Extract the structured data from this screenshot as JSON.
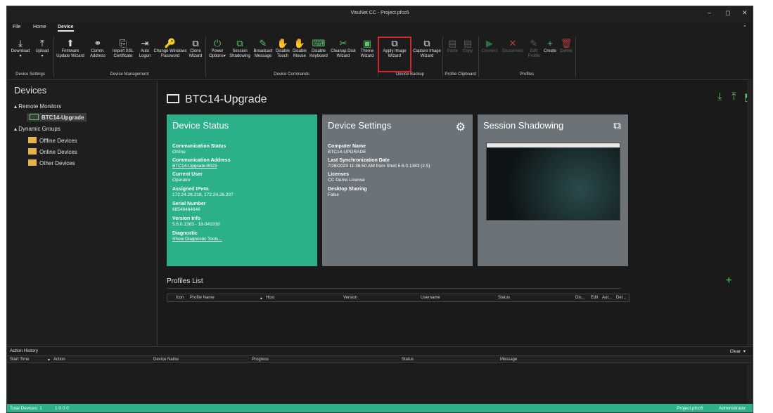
{
  "window": {
    "title": "VisuNet CC - Project.pfcc6",
    "minimize": "–",
    "maximize": "◻",
    "close": "✕"
  },
  "menu": {
    "file": "File",
    "home": "Home",
    "device": "Device",
    "collapse": "⌃"
  },
  "ribbon": {
    "buttons": [
      {
        "label": "Download",
        "icon": "⤓"
      },
      {
        "label": "Upload",
        "icon": "⤒"
      },
      {
        "label": "Firmware Update Wizard",
        "icon": "⬆"
      },
      {
        "label": "Comm. Address",
        "icon": "⚭"
      },
      {
        "label": "Import SSL Certificate",
        "icon": "⎘"
      },
      {
        "label": "Auto Logon",
        "icon": "⇥"
      },
      {
        "label": "Change Windows Password",
        "icon": "🔑"
      },
      {
        "label": "Clone Wizard",
        "icon": "⧉"
      },
      {
        "label": "Power Options",
        "icon": "⏻"
      },
      {
        "label": "Session Shadowing",
        "icon": "⧉"
      },
      {
        "label": "Broadcast Message",
        "icon": "✎"
      },
      {
        "label": "Disable Touch",
        "icon": "✋"
      },
      {
        "label": "Disable Mouse",
        "icon": "✋"
      },
      {
        "label": "Disable Keyboard",
        "icon": "⌨"
      },
      {
        "label": "Cleanup Disk Wizard",
        "icon": "✂"
      },
      {
        "label": "Theme Wizard",
        "icon": "▣"
      },
      {
        "label": "Apply Image Wizard",
        "icon": "⧉"
      },
      {
        "label": "Capture Image Wizard",
        "icon": "⧉"
      },
      {
        "label": "Paste",
        "icon": "▤"
      },
      {
        "label": "Copy",
        "icon": "▤"
      },
      {
        "label": "Connect",
        "icon": "▶"
      },
      {
        "label": "Disconnect",
        "icon": "✕"
      },
      {
        "label": "Edit Profile",
        "icon": "✎"
      },
      {
        "label": "Create",
        "icon": "+"
      },
      {
        "label": "Delete",
        "icon": "🗑"
      }
    ],
    "groups": [
      "Device Settings",
      "Device Management",
      "Device Commands",
      "Device Backup",
      "Profile Clipboard",
      "Profiles"
    ],
    "download_arrow": "▾",
    "upload_arrow": "▾",
    "power_arrow": "▾"
  },
  "sidebar": {
    "title": "Devices",
    "remote_monitors": "Remote Monitors",
    "selected_device": "BTC14-Upgrade",
    "dynamic_groups": "Dynamic Groups",
    "groups": [
      "Offline Devices",
      "Online Devices",
      "Other Devices"
    ]
  },
  "device": {
    "name": "BTC14-Upgrade",
    "status_card": {
      "title": "Device Status",
      "fields": [
        {
          "label": "Communication Status",
          "value": "Online"
        },
        {
          "label": "Communication Address",
          "value": "BTC14-Upgrade:8023"
        },
        {
          "label": "Current User",
          "value": "Operator"
        },
        {
          "label": "Assigned IPv4s",
          "value": "172.24.26.218, 172.24.26.207"
        },
        {
          "label": "Serial Number",
          "value": "68548464646"
        },
        {
          "label": "Version Info",
          "value": "5.6.0.1383 - 18-341918"
        },
        {
          "label": "Diagnostic",
          "value": "Show Diagnostic Tools..."
        }
      ]
    },
    "settings_card": {
      "title": "Device Settings",
      "fields": [
        {
          "label": "Computer Name",
          "value": "BTC14-UPGRADE"
        },
        {
          "label": "Last Synchronization Date",
          "value": "7/26/2023 11:36:50 AM from Shell 5.6.0.1383 (2.5)"
        },
        {
          "label": "Licenses",
          "value": "CC Demo License"
        },
        {
          "label": "Desktop Sharing",
          "value": "False"
        }
      ]
    },
    "shadow_card": {
      "title": "Session Shadowing"
    }
  },
  "profiles": {
    "title": "Profiles List",
    "columns": [
      "Icon",
      "Profile Name",
      "Host",
      "Version",
      "Username",
      "Status",
      "Dis...",
      "Edit",
      "Aut...",
      "Del..."
    ]
  },
  "action_history": {
    "title": "Action History",
    "clear": "Clear",
    "columns": [
      "Start Time",
      "Action",
      "Device Name",
      "Progress",
      "Status",
      "Message"
    ]
  },
  "status_bar": {
    "total_devices": "Total Devices: 1",
    "counts": "1  0  0  0",
    "project": "Project.pfcc6",
    "user": "Administrator"
  },
  "colors": {
    "accent": "#2bb08a",
    "highlight": "#d9232d",
    "card_grey": "#6b7379"
  }
}
